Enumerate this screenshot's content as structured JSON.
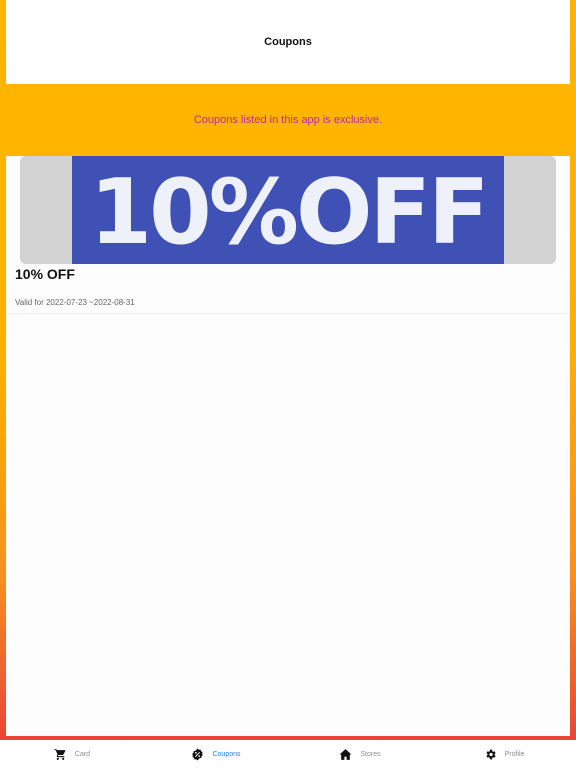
{
  "header": {
    "title": "Coupons"
  },
  "notice": {
    "text": "Coupons listed in this app is exclusive."
  },
  "coupons": [
    {
      "banner_text": "10%OFF",
      "title": "10% OFF",
      "validity": "Valid for 2022-07-23 ~2022-08-31"
    }
  ],
  "tabbar": {
    "active": "Coupons",
    "items": [
      {
        "label": "Card",
        "icon": "cart-icon"
      },
      {
        "label": "Coupons",
        "icon": "coupon-badge-icon"
      },
      {
        "label": "Stores",
        "icon": "home-icon"
      },
      {
        "label": "Profile",
        "icon": "gear-icon"
      }
    ]
  },
  "colors": {
    "brand_orange": "#ffb400",
    "notice_text": "#c2279c",
    "banner_blue": "#3f51b5",
    "tab_active": "#2f7fd0",
    "tab_inactive": "#8e8e8e"
  }
}
